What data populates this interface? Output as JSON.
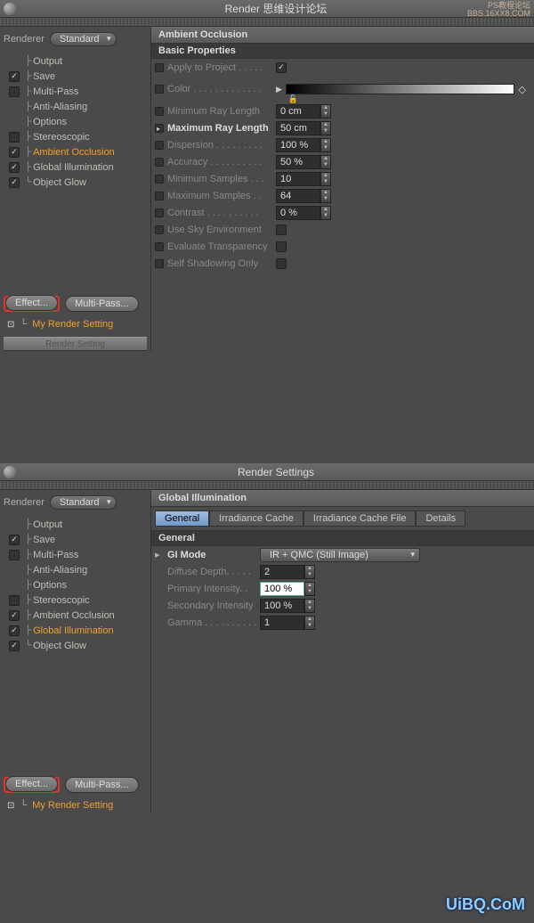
{
  "window1": {
    "title": "Render 思维设计论坛",
    "watermark1": "PS教程论坛",
    "watermark2": "BBS.16XX8.COM",
    "renderer_label": "Renderer",
    "renderer_value": "Standard",
    "tree": [
      {
        "check": null,
        "label": "Output"
      },
      {
        "check": "on",
        "label": "Save"
      },
      {
        "check": "off",
        "label": "Multi-Pass"
      },
      {
        "check": null,
        "label": "Anti-Aliasing"
      },
      {
        "check": null,
        "label": "Options"
      },
      {
        "check": "off",
        "label": "Stereoscopic"
      },
      {
        "check": "on",
        "label": "Ambient Occlusion",
        "selected": true
      },
      {
        "check": "on",
        "label": "Global Illumination"
      },
      {
        "check": "on",
        "label": "Object Glow"
      }
    ],
    "effect_btn": "Effect...",
    "multipass_btn": "Multi-Pass...",
    "preset": "My Render Setting",
    "divider": "Render Setting",
    "panel_title": "Ambient Occlusion",
    "section": "Basic Properties",
    "props": {
      "apply_to_project": "Apply to Project . . . . .",
      "color": "Color . . . . . . . . . . . . .",
      "min_ray": "Minimum Ray Length",
      "max_ray": "Maximum Ray Length",
      "dispersion": "Dispersion . . . . . . . . .",
      "accuracy": "Accuracy . . . . . . . . . .",
      "min_samples": "Minimum Samples . . .",
      "max_samples": "Maximum Samples . .",
      "contrast": "Contrast . . . . . . . . . .",
      "use_sky": "Use Sky Environment",
      "eval_trans": "Evaluate Transparency",
      "self_shadow": "Self Shadowing Only"
    },
    "vals": {
      "min_ray": "0 cm",
      "max_ray": "50 cm",
      "dispersion": "100 %",
      "accuracy": "50 %",
      "min_samples": "10",
      "max_samples": "64",
      "contrast": "0 %"
    }
  },
  "window2": {
    "title": "Render Settings",
    "renderer_label": "Renderer",
    "renderer_value": "Standard",
    "tree": [
      {
        "check": null,
        "label": "Output"
      },
      {
        "check": "on",
        "label": "Save"
      },
      {
        "check": "off",
        "label": "Multi-Pass"
      },
      {
        "check": null,
        "label": "Anti-Aliasing"
      },
      {
        "check": null,
        "label": "Options"
      },
      {
        "check": "off",
        "label": "Stereoscopic"
      },
      {
        "check": "on",
        "label": "Ambient Occlusion"
      },
      {
        "check": "on",
        "label": "Global Illumination",
        "selected": true
      },
      {
        "check": "on",
        "label": "Object Glow"
      }
    ],
    "effect_btn": "Effect...",
    "multipass_btn": "Multi-Pass...",
    "preset": "My Render Setting",
    "panel_title": "Global Illumination",
    "tabs": [
      "General",
      "Irradiance Cache",
      "Irradiance Cache File",
      "Details"
    ],
    "section": "General",
    "props": {
      "gi_mode": "GI Mode",
      "gi_mode_val": "IR + QMC (Still Image)",
      "diffuse_depth": "Diffuse Depth. . . . .",
      "primary": "Primary Intensity. .",
      "secondary": "Secondary Intensity",
      "gamma": "Gamma . . . . . . . . . ."
    },
    "vals": {
      "diffuse_depth": "2",
      "primary": "100 %",
      "secondary": "100 %",
      "gamma": "1"
    }
  },
  "logo": "UiBQ.CoM"
}
